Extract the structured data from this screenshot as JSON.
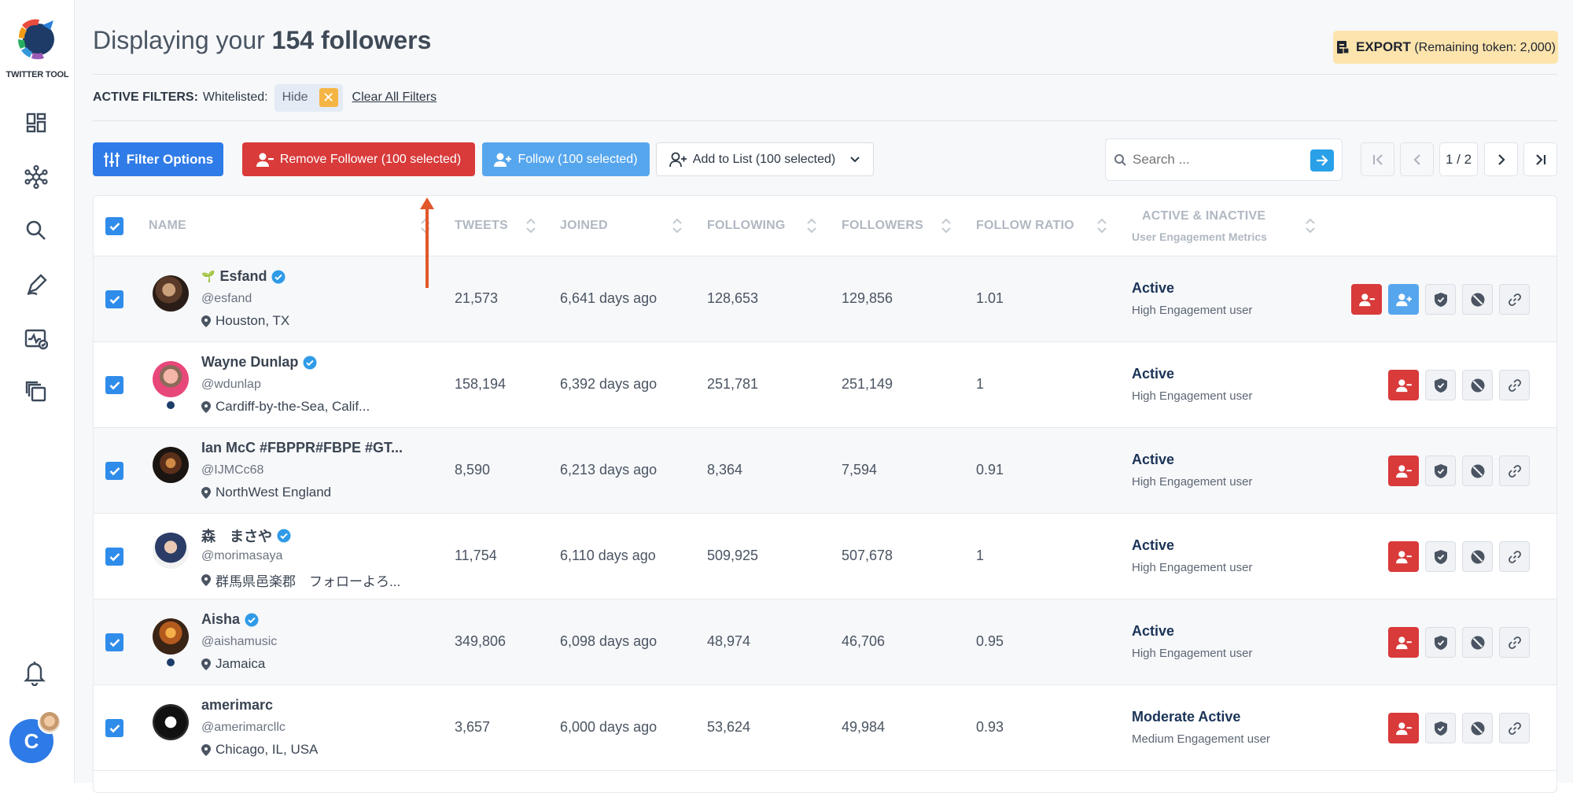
{
  "app": {
    "logo_text": "TWITTER TOOL",
    "user_initial": "C"
  },
  "sidebar": {
    "items": [
      {
        "icon": "dashboard-icon"
      },
      {
        "icon": "network-icon"
      },
      {
        "icon": "search-icon"
      },
      {
        "icon": "edit-icon"
      },
      {
        "icon": "analytics-icon"
      },
      {
        "icon": "copy-icon"
      }
    ],
    "bell_icon": "bell-icon"
  },
  "header": {
    "title_prefix": "Displaying your ",
    "title_bold": "154 followers",
    "export_label": "EXPORT",
    "export_note": "(Remaining token: 2,000)"
  },
  "filters": {
    "label": "ACTIVE FILTERS:",
    "whitelisted_label": "Whitelisted:",
    "chip_value": "Hide",
    "clear_label": "Clear All Filters"
  },
  "toolbar": {
    "filter_options": "Filter Options",
    "remove_follower": "Remove Follower (100 selected)",
    "follow": "Follow (100 selected)",
    "add_to_list": "Add to List (100 selected)"
  },
  "search": {
    "placeholder": "Search ..."
  },
  "pagination": {
    "current": "1 / 2"
  },
  "table": {
    "columns": {
      "name": "NAME",
      "tweets": "TWEETS",
      "joined": "JOINED",
      "following": "FOLLOWING",
      "followers": "FOLLOWERS",
      "ratio": "FOLLOW RATIO",
      "activity": "ACTIVE & INACTIVE",
      "activity_sub": "User Engagement Metrics"
    },
    "rows": [
      {
        "prefix": "🌱",
        "name": "Esfand",
        "verified": true,
        "handle": "@esfand",
        "location": "Houston, TX",
        "tweets": "21,573",
        "joined": "6,641 days ago",
        "following": "128,653",
        "followers": "129,856",
        "ratio": "1.01",
        "status": "Active",
        "engagement": "High Engagement user",
        "follow_btn": true
      },
      {
        "prefix": "",
        "name": "Wayne Dunlap",
        "verified": true,
        "handle": "@wdunlap",
        "location": "Cardiff-by-the-Sea, Calif...",
        "tweets": "158,194",
        "joined": "6,392 days ago",
        "following": "251,781",
        "followers": "251,149",
        "ratio": "1",
        "status": "Active",
        "engagement": "High Engagement user",
        "follow_btn": false
      },
      {
        "prefix": "",
        "name": "Ian McC #FBPPR#FBPE #GT...",
        "verified": false,
        "handle": "@IJMCc68",
        "location": "NorthWest England",
        "tweets": "8,590",
        "joined": "6,213 days ago",
        "following": "8,364",
        "followers": "7,594",
        "ratio": "0.91",
        "status": "Active",
        "engagement": "High Engagement user",
        "follow_btn": false
      },
      {
        "prefix": "",
        "name": "森　まさや",
        "verified": true,
        "handle": "@morimasaya",
        "location": "群馬県邑楽郡　フォローよろ...",
        "tweets": "11,754",
        "joined": "6,110 days ago",
        "following": "509,925",
        "followers": "507,678",
        "ratio": "1",
        "status": "Active",
        "engagement": "High Engagement user",
        "follow_btn": false
      },
      {
        "prefix": "",
        "name": "Aisha",
        "verified": true,
        "handle": "@aishamusic",
        "location": "Jamaica",
        "tweets": "349,806",
        "joined": "6,098 days ago",
        "following": "48,974",
        "followers": "46,706",
        "ratio": "0.95",
        "status": "Active",
        "engagement": "High Engagement user",
        "follow_btn": false
      },
      {
        "prefix": "",
        "name": "amerimarc",
        "verified": false,
        "handle": "@amerimarcllc",
        "location": "Chicago, IL, USA",
        "tweets": "3,657",
        "joined": "6,000 days ago",
        "following": "53,624",
        "followers": "49,984",
        "ratio": "0.93",
        "status": "Moderate Active",
        "engagement": "Medium Engagement user",
        "follow_btn": false
      }
    ]
  },
  "colors": {
    "primary": "#2f7be8",
    "danger": "#d93a3a",
    "info": "#56a6ee",
    "accent_arrow": "#e2572b",
    "export_bg": "#fde4ad"
  }
}
